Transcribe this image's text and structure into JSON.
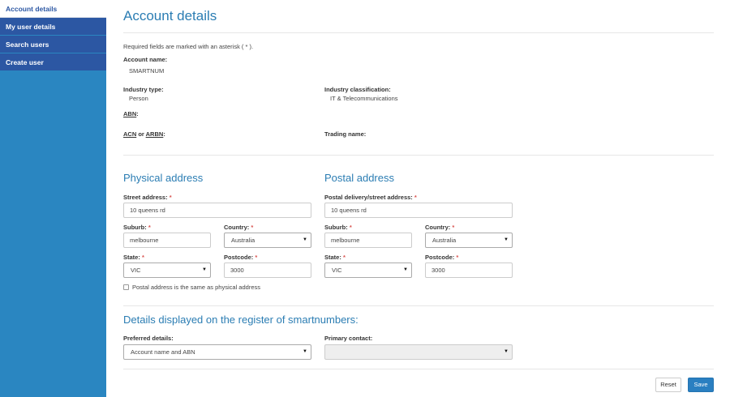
{
  "sidebar": {
    "items": [
      {
        "label": "Account details"
      },
      {
        "label": "My user details"
      },
      {
        "label": "Search users"
      },
      {
        "label": "Create user"
      }
    ]
  },
  "page": {
    "title": "Account details",
    "required_note": "Required fields are marked with an asterisk ( * )."
  },
  "account": {
    "name_label": "Account name:",
    "name_value": "SMARTNUM",
    "industry_type_label": "Industry type:",
    "industry_type_value": "Person",
    "industry_class_label": "Industry classification:",
    "industry_class_value": "IT & Telecommunications",
    "abn_label": "ABN",
    "abn_colon": ":",
    "acn_label_a": "ACN",
    "acn_or": " or ",
    "acn_label_b": "ARBN",
    "acn_colon": ":",
    "trading_label": "Trading name:"
  },
  "physical": {
    "heading": "Physical address",
    "street_label": "Street address:",
    "street_value": "10 queens rd",
    "suburb_label": "Suburb:",
    "suburb_value": "melbourne",
    "country_label": "Country:",
    "country_value": "Australia",
    "state_label": "State:",
    "state_value": "VIC",
    "postcode_label": "Postcode:",
    "postcode_value": "3000",
    "same_label": "Postal address is the same as physical address"
  },
  "postal": {
    "heading": "Postal address",
    "street_label": "Postal delivery/street address:",
    "street_value": "10 queens rd",
    "suburb_label": "Suburb:",
    "suburb_value": "melbourne",
    "country_label": "Country:",
    "country_value": "Australia",
    "state_label": "State:",
    "state_value": "VIC",
    "postcode_label": "Postcode:",
    "postcode_value": "3000"
  },
  "register": {
    "heading": "Details displayed on the register of smartnumbers:",
    "preferred_label": "Preferred details:",
    "preferred_value": "Account name and ABN",
    "primary_label": "Primary contact:",
    "primary_value": ""
  },
  "common": {
    "asterisk": "*",
    "caret": "▼"
  },
  "actions": {
    "reset": "Reset",
    "save": "Save"
  },
  "colors": {
    "sidebar_bg": "#2a86c1",
    "nav_bg": "#2c57a3",
    "heading": "#2b7db3",
    "primary_button": "#2a7fc1",
    "required": "#d9534f"
  }
}
